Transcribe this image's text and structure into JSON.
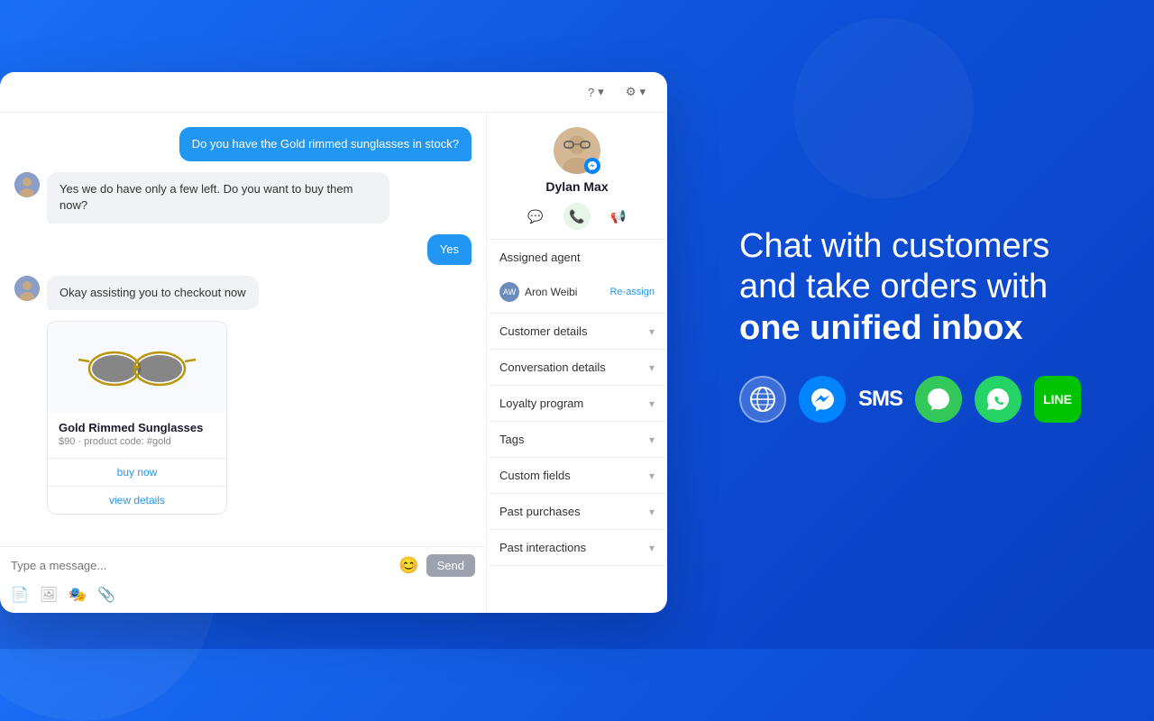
{
  "topbar": {
    "help_label": "?",
    "settings_label": "⚙"
  },
  "chat": {
    "user_message": "Do you have the Gold rimmed sunglasses in stock?",
    "agent_reply": "Yes we do have only a few left. Do you want to buy them now?",
    "user_confirm": "Yes",
    "agent_assist": "Okay assisting you to checkout now",
    "input_placeholder": "Type a message...",
    "send_label": "Send"
  },
  "product": {
    "name": "Gold Rimmed Sunglasses",
    "price": "$90",
    "product_code": "product code: #gold",
    "buy_label": "buy now",
    "details_label": "view details"
  },
  "contact": {
    "name": "Dylan Max",
    "channel": "messenger"
  },
  "sidebar": {
    "assigned_agent_label": "Assigned agent",
    "agent_name": "Aron Weibi",
    "reassign_label": "Re-assign",
    "sections": [
      {
        "id": "customer-details",
        "label": "Customer details"
      },
      {
        "id": "conversation-details",
        "label": "Conversation details"
      },
      {
        "id": "loyalty-program",
        "label": "Loyalty program"
      },
      {
        "id": "tags",
        "label": "Tags"
      },
      {
        "id": "custom-fields",
        "label": "Custom fields"
      },
      {
        "id": "past-purchases",
        "label": "Past purchases"
      },
      {
        "id": "past-interactions",
        "label": "Past interactions"
      }
    ]
  },
  "marketing": {
    "headline_part1": "Chat with customers\nand take orders with\n",
    "headline_bold": "one unified inbox",
    "channels": [
      {
        "id": "globe",
        "label": "Globe",
        "symbol": "🌐"
      },
      {
        "id": "messenger",
        "label": "Messenger",
        "symbol": "⚡"
      },
      {
        "id": "sms",
        "label": "SMS",
        "symbol": "SMS"
      },
      {
        "id": "imessage",
        "label": "iMessage",
        "symbol": "💬"
      },
      {
        "id": "whatsapp",
        "label": "WhatsApp",
        "symbol": "📱"
      },
      {
        "id": "line",
        "label": "LINE",
        "symbol": "LINE"
      }
    ]
  }
}
